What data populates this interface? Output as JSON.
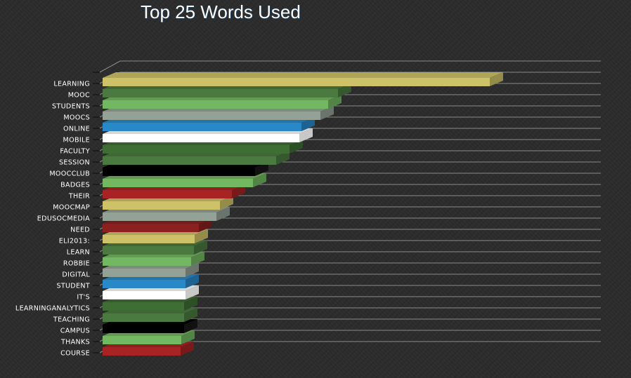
{
  "chart_data": {
    "type": "bar",
    "orientation": "horizontal",
    "style": "3d",
    "title": "Top 25 Words Used",
    "xlabel": "",
    "ylabel": "",
    "value_axis_labels_shown": false,
    "grid": true,
    "legend": "none",
    "value_units": "relative (no value axis shown)",
    "categories": [
      "LEARNING",
      "MOOC",
      "STUDENTS",
      "MOOCS",
      "ONLINE",
      "MOBILE",
      "FACULTY",
      "SESSION",
      "MOOCCLUB",
      "BADGES",
      "THEIR",
      "MOOCMAP",
      "EDUSOCMEDIA",
      "NEED",
      "ELI2013:",
      "LEARN",
      "ROBBIE",
      "DIGITAL",
      "STUDENT",
      "IT'S",
      "LEARNINGANALYTICS",
      "TEACHING",
      "CAMPUS",
      "THANKS",
      "COURSE"
    ],
    "values": [
      551,
      335,
      321,
      310,
      283,
      280,
      266,
      247,
      217,
      214,
      184,
      167,
      162,
      137,
      131,
      130,
      126,
      118,
      118,
      118,
      116,
      116,
      116,
      112,
      111
    ],
    "xlim": [
      0,
      685
    ],
    "colors": [
      "#cec268",
      "#4a7a40",
      "#72b860",
      "#94a196",
      "#2888c8",
      "#ffffff",
      "#3f6e35",
      "#4a7a40",
      "#000000",
      "#72b860",
      "#a82424",
      "#cec268",
      "#94a196",
      "#8b2020",
      "#cec268",
      "#4a7a40",
      "#72b860",
      "#94a196",
      "#2888c8",
      "#ffffff",
      "#3f6e35",
      "#4a7a40",
      "#000000",
      "#72b860",
      "#a82424"
    ]
  }
}
